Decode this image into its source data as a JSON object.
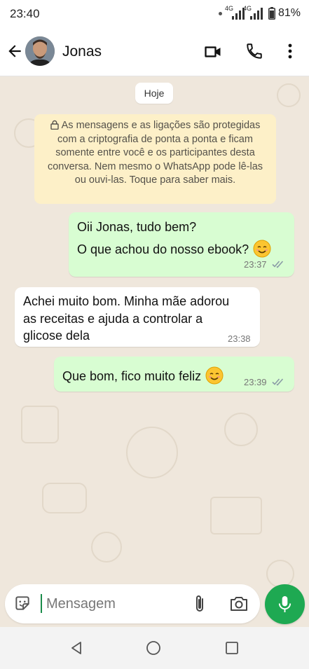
{
  "status_bar": {
    "time": "23:40",
    "network_1": "4G",
    "network_2": "4G",
    "battery": "81%"
  },
  "header": {
    "contact_name": "Jonas"
  },
  "chat": {
    "date_chip": "Hoje",
    "encryption_notice": "As mensagens e as ligações são protegidas com a criptografia de ponta a ponta e ficam somente entre você e os participantes desta conversa. Nem mesmo o WhatsApp pode lê-las ou ouvi-las. Toque para saber mais.",
    "messages": [
      {
        "direction": "outgoing",
        "line1": "Oii Jonas, tudo bem?",
        "line2": "O que achou do nosso ebook?",
        "emoji": "smiling-face",
        "time": "23:37",
        "status": "read"
      },
      {
        "direction": "incoming",
        "text": "Achei muito bom. Minha mãe adorou as receitas e ajuda a controlar a glicose dela",
        "time": "23:38"
      },
      {
        "direction": "outgoing",
        "text": "Que bom, fico muito feliz",
        "emoji": "smiling-face",
        "time": "23:39",
        "status": "read"
      }
    ]
  },
  "composer": {
    "placeholder": "Mensagem"
  },
  "colors": {
    "accent": "#1ea952",
    "outgoing_bubble": "#d8fdd2",
    "notice_bg": "#fdf0c8",
    "chat_bg": "#efe7dc"
  }
}
